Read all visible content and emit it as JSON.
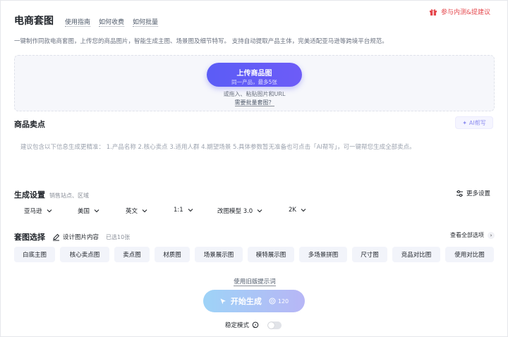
{
  "header": {
    "title": "电商套图",
    "links": [
      "使用指南",
      "如何收费",
      "如何批量"
    ],
    "feedback": "参与内测&提建议"
  },
  "description": "一键制作同款电商套图，上传您的商品图片，智能生成主图、场景图及细节特写。 支持自动提取产品主体，完美适配亚马逊等跨境平台规范。",
  "upload": {
    "button_label": "上传商品图",
    "button_sub": "同一产品，最多5张",
    "hint": "或拖入、粘贴图片和URL",
    "batch_link": "需要批量套图？"
  },
  "selling_points": {
    "title": "商品卖点",
    "ai_button": "AI帮写",
    "placeholder": "建议包含以下信息生成更精准：  1.产品名称  2.核心卖点  3.适用人群  4.期望场景  5.具体参数暂无准备也可点击「AI帮写」，可一键帮您生成全部卖点。"
  },
  "generate_settings": {
    "title": "生成设置",
    "subtitle": "销售站点、区域",
    "more_settings": "更多设置",
    "selects": [
      "亚马逊",
      "美国",
      "英文",
      "1:1",
      "改图模型 3.0",
      "2K"
    ]
  },
  "tao_select": {
    "title": "套图选择",
    "design_link": "设计图片内容",
    "selected_count": "已选10张",
    "view_all": "查看全部选项",
    "chips": [
      "白底主图",
      "核心卖点图",
      "卖点图",
      "材质图",
      "场景展示图",
      "模特展示图",
      "多场景拼图",
      "尺寸图",
      "竞品对比图",
      "使用对比图"
    ]
  },
  "footer": {
    "old_prompt": "使用旧版提示词",
    "generate_label": "开始生成",
    "cost": "120",
    "stable_mode": "稳定模式",
    "stable_on": false
  },
  "colors": {
    "accent": "#5b5cf6",
    "feedback": "#e5484d",
    "chip_bg": "#f2f4fa"
  }
}
